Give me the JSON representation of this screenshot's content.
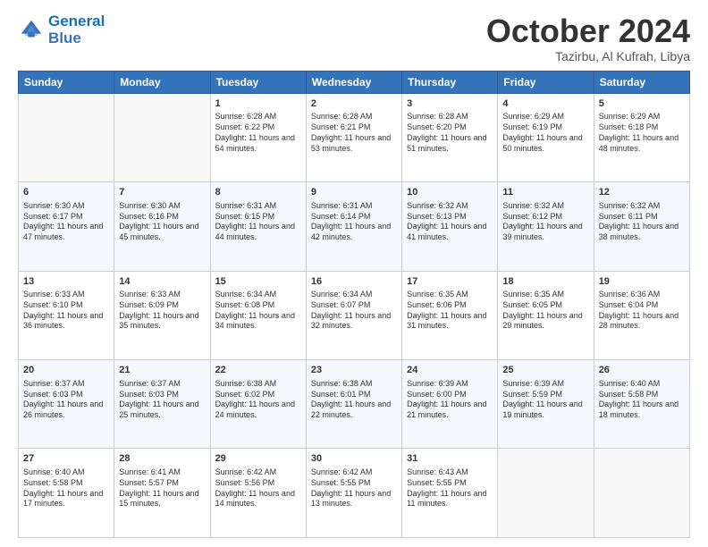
{
  "header": {
    "logo_line1": "General",
    "logo_line2": "Blue",
    "month": "October 2024",
    "location": "Tazirbu, Al Kufrah, Libya"
  },
  "weekdays": [
    "Sunday",
    "Monday",
    "Tuesday",
    "Wednesday",
    "Thursday",
    "Friday",
    "Saturday"
  ],
  "weeks": [
    [
      {
        "day": "",
        "sunrise": "",
        "sunset": "",
        "daylight": ""
      },
      {
        "day": "",
        "sunrise": "",
        "sunset": "",
        "daylight": ""
      },
      {
        "day": "1",
        "sunrise": "Sunrise: 6:28 AM",
        "sunset": "Sunset: 6:22 PM",
        "daylight": "Daylight: 11 hours and 54 minutes."
      },
      {
        "day": "2",
        "sunrise": "Sunrise: 6:28 AM",
        "sunset": "Sunset: 6:21 PM",
        "daylight": "Daylight: 11 hours and 53 minutes."
      },
      {
        "day": "3",
        "sunrise": "Sunrise: 6:28 AM",
        "sunset": "Sunset: 6:20 PM",
        "daylight": "Daylight: 11 hours and 51 minutes."
      },
      {
        "day": "4",
        "sunrise": "Sunrise: 6:29 AM",
        "sunset": "Sunset: 6:19 PM",
        "daylight": "Daylight: 11 hours and 50 minutes."
      },
      {
        "day": "5",
        "sunrise": "Sunrise: 6:29 AM",
        "sunset": "Sunset: 6:18 PM",
        "daylight": "Daylight: 11 hours and 48 minutes."
      }
    ],
    [
      {
        "day": "6",
        "sunrise": "Sunrise: 6:30 AM",
        "sunset": "Sunset: 6:17 PM",
        "daylight": "Daylight: 11 hours and 47 minutes."
      },
      {
        "day": "7",
        "sunrise": "Sunrise: 6:30 AM",
        "sunset": "Sunset: 6:16 PM",
        "daylight": "Daylight: 11 hours and 45 minutes."
      },
      {
        "day": "8",
        "sunrise": "Sunrise: 6:31 AM",
        "sunset": "Sunset: 6:15 PM",
        "daylight": "Daylight: 11 hours and 44 minutes."
      },
      {
        "day": "9",
        "sunrise": "Sunrise: 6:31 AM",
        "sunset": "Sunset: 6:14 PM",
        "daylight": "Daylight: 11 hours and 42 minutes."
      },
      {
        "day": "10",
        "sunrise": "Sunrise: 6:32 AM",
        "sunset": "Sunset: 6:13 PM",
        "daylight": "Daylight: 11 hours and 41 minutes."
      },
      {
        "day": "11",
        "sunrise": "Sunrise: 6:32 AM",
        "sunset": "Sunset: 6:12 PM",
        "daylight": "Daylight: 11 hours and 39 minutes."
      },
      {
        "day": "12",
        "sunrise": "Sunrise: 6:32 AM",
        "sunset": "Sunset: 6:11 PM",
        "daylight": "Daylight: 11 hours and 38 minutes."
      }
    ],
    [
      {
        "day": "13",
        "sunrise": "Sunrise: 6:33 AM",
        "sunset": "Sunset: 6:10 PM",
        "daylight": "Daylight: 11 hours and 36 minutes."
      },
      {
        "day": "14",
        "sunrise": "Sunrise: 6:33 AM",
        "sunset": "Sunset: 6:09 PM",
        "daylight": "Daylight: 11 hours and 35 minutes."
      },
      {
        "day": "15",
        "sunrise": "Sunrise: 6:34 AM",
        "sunset": "Sunset: 6:08 PM",
        "daylight": "Daylight: 11 hours and 34 minutes."
      },
      {
        "day": "16",
        "sunrise": "Sunrise: 6:34 AM",
        "sunset": "Sunset: 6:07 PM",
        "daylight": "Daylight: 11 hours and 32 minutes."
      },
      {
        "day": "17",
        "sunrise": "Sunrise: 6:35 AM",
        "sunset": "Sunset: 6:06 PM",
        "daylight": "Daylight: 11 hours and 31 minutes."
      },
      {
        "day": "18",
        "sunrise": "Sunrise: 6:35 AM",
        "sunset": "Sunset: 6:05 PM",
        "daylight": "Daylight: 11 hours and 29 minutes."
      },
      {
        "day": "19",
        "sunrise": "Sunrise: 6:36 AM",
        "sunset": "Sunset: 6:04 PM",
        "daylight": "Daylight: 11 hours and 28 minutes."
      }
    ],
    [
      {
        "day": "20",
        "sunrise": "Sunrise: 6:37 AM",
        "sunset": "Sunset: 6:03 PM",
        "daylight": "Daylight: 11 hours and 26 minutes."
      },
      {
        "day": "21",
        "sunrise": "Sunrise: 6:37 AM",
        "sunset": "Sunset: 6:03 PM",
        "daylight": "Daylight: 11 hours and 25 minutes."
      },
      {
        "day": "22",
        "sunrise": "Sunrise: 6:38 AM",
        "sunset": "Sunset: 6:02 PM",
        "daylight": "Daylight: 11 hours and 24 minutes."
      },
      {
        "day": "23",
        "sunrise": "Sunrise: 6:38 AM",
        "sunset": "Sunset: 6:01 PM",
        "daylight": "Daylight: 11 hours and 22 minutes."
      },
      {
        "day": "24",
        "sunrise": "Sunrise: 6:39 AM",
        "sunset": "Sunset: 6:00 PM",
        "daylight": "Daylight: 11 hours and 21 minutes."
      },
      {
        "day": "25",
        "sunrise": "Sunrise: 6:39 AM",
        "sunset": "Sunset: 5:59 PM",
        "daylight": "Daylight: 11 hours and 19 minutes."
      },
      {
        "day": "26",
        "sunrise": "Sunrise: 6:40 AM",
        "sunset": "Sunset: 5:58 PM",
        "daylight": "Daylight: 11 hours and 18 minutes."
      }
    ],
    [
      {
        "day": "27",
        "sunrise": "Sunrise: 6:40 AM",
        "sunset": "Sunset: 5:58 PM",
        "daylight": "Daylight: 11 hours and 17 minutes."
      },
      {
        "day": "28",
        "sunrise": "Sunrise: 6:41 AM",
        "sunset": "Sunset: 5:57 PM",
        "daylight": "Daylight: 11 hours and 15 minutes."
      },
      {
        "day": "29",
        "sunrise": "Sunrise: 6:42 AM",
        "sunset": "Sunset: 5:56 PM",
        "daylight": "Daylight: 11 hours and 14 minutes."
      },
      {
        "day": "30",
        "sunrise": "Sunrise: 6:42 AM",
        "sunset": "Sunset: 5:55 PM",
        "daylight": "Daylight: 11 hours and 13 minutes."
      },
      {
        "day": "31",
        "sunrise": "Sunrise: 6:43 AM",
        "sunset": "Sunset: 5:55 PM",
        "daylight": "Daylight: 11 hours and 11 minutes."
      },
      {
        "day": "",
        "sunrise": "",
        "sunset": "",
        "daylight": ""
      },
      {
        "day": "",
        "sunrise": "",
        "sunset": "",
        "daylight": ""
      }
    ]
  ]
}
